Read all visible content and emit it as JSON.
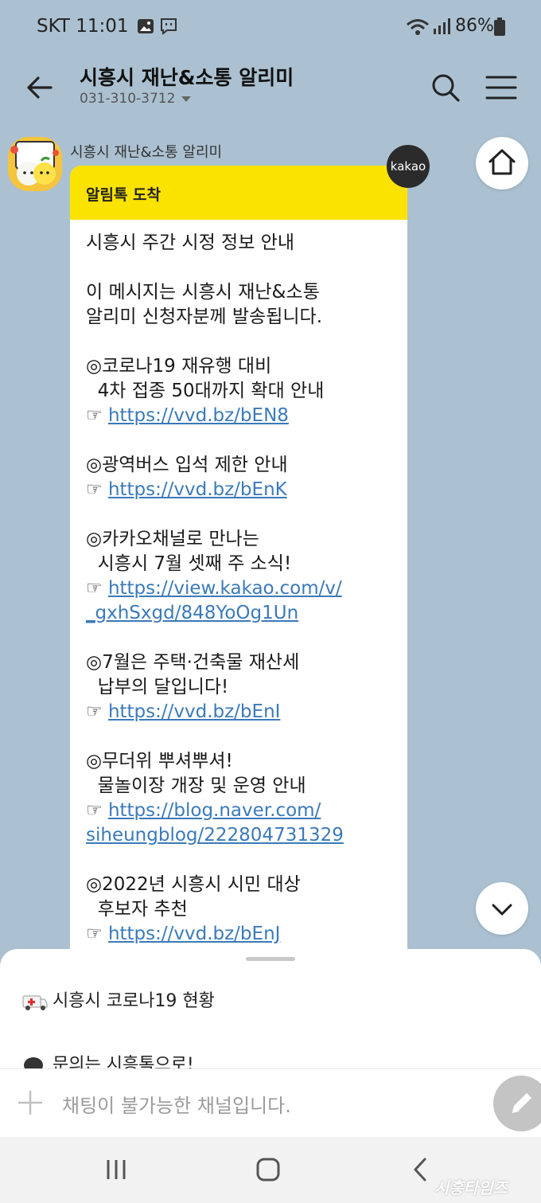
{
  "status_bar": {
    "carrier_time": "SKT 11:01",
    "battery": "86%"
  },
  "header": {
    "title": "시흥시 재난&소통 알리미",
    "phone": "031-310-3712"
  },
  "chat": {
    "sender": "시흥시 재난&소통 알리미",
    "badge": "kakao",
    "bubble_title": "알림톡 도착",
    "lines": [
      {
        "t": "시흥시 주간 시정 정보 안내"
      },
      {
        "t": ""
      },
      {
        "t": "이 메시지는 시흥시 재난&소통"
      },
      {
        "t": "알리미 신청자분께 발송됩니다."
      },
      {
        "t": ""
      },
      {
        "t": "◎코로나19 재유행 대비"
      },
      {
        "t": "  4차 접종 50대까지 확대 안내"
      },
      {
        "p": "☞ ",
        "l": "https://vvd.bz/bEN8"
      },
      {
        "t": ""
      },
      {
        "t": "◎광역버스 입석 제한 안내"
      },
      {
        "p": "☞ ",
        "l": "https://vvd.bz/bEnK"
      },
      {
        "t": ""
      },
      {
        "t": "◎카카오채널로 만나는"
      },
      {
        "t": "  시흥시 7월 셋째 주 소식!"
      },
      {
        "p": "☞ ",
        "l": "https://view.kakao.com/v/"
      },
      {
        "l": "_gxhSxgd/848YoOg1Un"
      },
      {
        "t": ""
      },
      {
        "t": "◎7월은 주택·건축물 재산세"
      },
      {
        "t": "  납부의 달입니다!"
      },
      {
        "p": "☞ ",
        "l": "https://vvd.bz/bEnI"
      },
      {
        "t": ""
      },
      {
        "t": "◎무더위 뿌셔뿌셔!"
      },
      {
        "t": "  물놀이장 개장 및 운영 안내"
      },
      {
        "p": "☞ ",
        "l": "https://blog.naver.com/"
      },
      {
        "l": "siheungblog/222804731329"
      },
      {
        "t": ""
      },
      {
        "t": "◎2022년 시흥시 시민 대상"
      },
      {
        "t": "  후보자 추천"
      },
      {
        "p": "☞ ",
        "l": "https://vvd.bz/bEnJ"
      }
    ]
  },
  "sheet": {
    "item1": "시흥시 코로나19 현황",
    "item2": "문의는 시흥톡으로!"
  },
  "input": {
    "placeholder": "채팅이 불가능한 채널입니다."
  },
  "watermark": "시흥타임즈",
  "colors": {
    "background": "#abc1d1",
    "bubble_header": "#fae300",
    "link": "#3b7ab9"
  },
  "icons": [
    "back-arrow-icon",
    "search-icon",
    "menu-icon",
    "home-icon",
    "chevron-down-icon",
    "plus-icon",
    "pencil-icon",
    "ambulance-icon"
  ]
}
